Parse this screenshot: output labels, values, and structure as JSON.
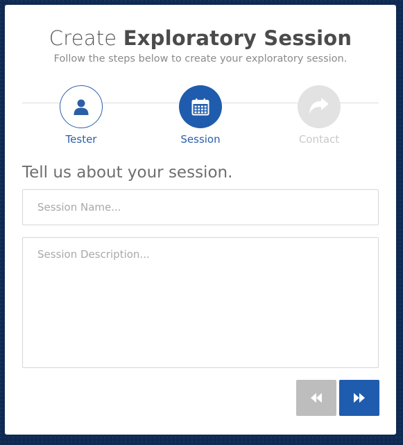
{
  "header": {
    "title_light": "Create",
    "title_bold": "Exploratory Session",
    "subtitle": "Follow the steps below to create your exploratory session."
  },
  "steps": [
    {
      "label": "Tester",
      "icon": "user-icon",
      "state": "completed"
    },
    {
      "label": "Session",
      "icon": "calendar-icon",
      "state": "active"
    },
    {
      "label": "Contact",
      "icon": "share-arrow-icon",
      "state": "inactive"
    }
  ],
  "form": {
    "heading": "Tell us about your session.",
    "name_placeholder": "Session Name...",
    "name_value": "",
    "description_placeholder": "Session Description...",
    "description_value": ""
  },
  "nav": {
    "back_icon": "fast-backward-icon",
    "next_icon": "fast-forward-icon"
  },
  "colors": {
    "primary": "#1f5cae",
    "disabled": "#bdbdbd",
    "step_inactive": "#e2e2e2",
    "background": "#0e2a52"
  }
}
